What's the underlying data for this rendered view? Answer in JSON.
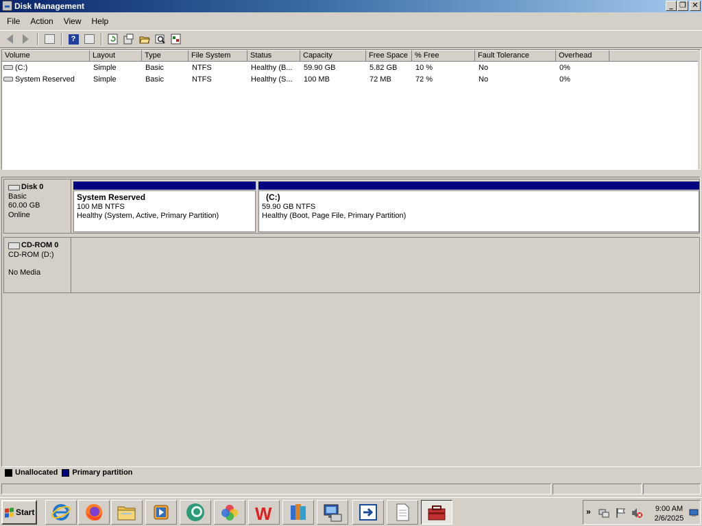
{
  "window": {
    "title": "Disk Management"
  },
  "window_buttons": {
    "minimize": "_",
    "restore": "❐",
    "close": "✕"
  },
  "menu": [
    "File",
    "Action",
    "View",
    "Help"
  ],
  "toolbar": {
    "icons": [
      "back-arrow-icon",
      "forward-arrow-icon",
      "show-hide-console-tree-icon",
      "help-icon",
      "show-hide-action-pane-icon",
      "refresh-icon",
      "properties-icon",
      "open-icon",
      "rescan-icon",
      "export-icon"
    ],
    "help_glyph": "?"
  },
  "volume_list": {
    "columns": [
      "Volume",
      "Layout",
      "Type",
      "File System",
      "Status",
      "Capacity",
      "Free Space",
      "% Free",
      "Fault Tolerance",
      "Overhead"
    ],
    "rows": [
      [
        "(C:)",
        "Simple",
        "Basic",
        "NTFS",
        "Healthy (B...",
        "59.90 GB",
        "5.82 GB",
        "10 %",
        "No",
        "0%"
      ],
      [
        "System Reserved",
        "Simple",
        "Basic",
        "NTFS",
        "Healthy (S...",
        "100 MB",
        "72 MB",
        "72 %",
        "No",
        "0%"
      ]
    ]
  },
  "disks": {
    "disk0": {
      "name": "Disk 0",
      "type": "Basic",
      "size": "60.00 GB",
      "state": "Online",
      "partitions": [
        {
          "title": "System Reserved",
          "size": "100 MB NTFS",
          "status": "Healthy (System, Active, Primary Partition)"
        },
        {
          "title": "(C:)",
          "size": "59.90 GB NTFS",
          "status": "Healthy (Boot, Page File, Primary Partition)"
        }
      ]
    },
    "cdrom0": {
      "name": "CD-ROM 0",
      "drive": "CD-ROM (D:)",
      "media": "No Media"
    }
  },
  "legend": [
    {
      "label": "Unallocated",
      "color": "#000000"
    },
    {
      "label": "Primary partition",
      "color": "#000080"
    }
  ],
  "taskbar": {
    "start": "Start",
    "apps": [
      "internet-explorer-icon",
      "firefox-icon",
      "file-explorer-icon",
      "media-player-icon",
      "chat-app-icon",
      "photos-icon",
      "wps-office-icon",
      "archive-icon",
      "remote-desktop-icon",
      "file-transfer-icon",
      "notepad-icon",
      "computer-management-icon"
    ],
    "wps_letter": "W",
    "expand_glyph": "»",
    "clock_time": "9:00 AM",
    "clock_date": "2/6/2025"
  },
  "colors": {
    "title_bar": "#0a246a",
    "partition_bar": "#000080",
    "chrome": "#d4d0c8"
  }
}
